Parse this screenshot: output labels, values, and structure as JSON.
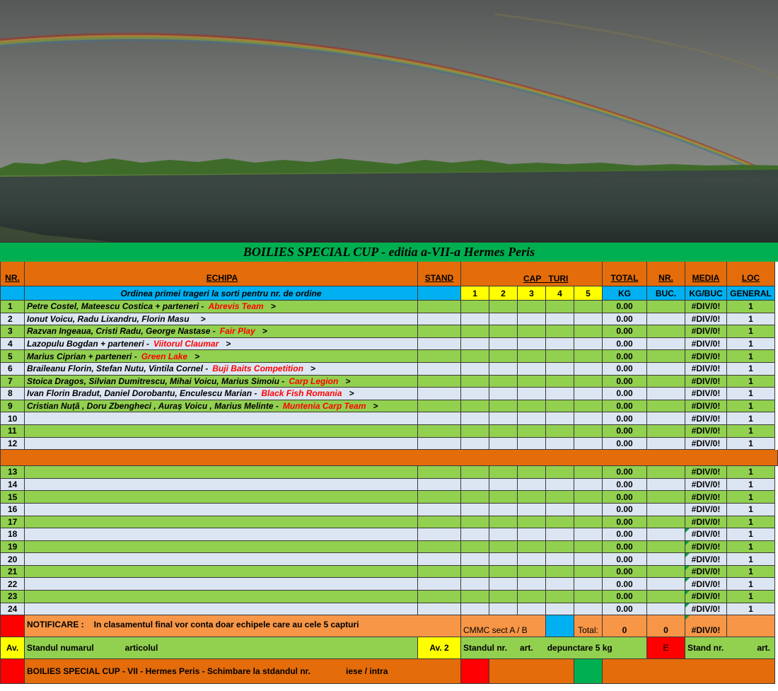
{
  "title": "BOILIES SPECIAL CUP - editia a-VII-a Hermes Peris",
  "headers": {
    "nr": "NR.",
    "echipa": "ECHIPA",
    "stand": "STAND",
    "cap": "CAP",
    "turi": "TURI",
    "total": "TOTAL",
    "nr_buc": "NR.",
    "media": "MEDIA",
    "loc": "LOC"
  },
  "subheaders": {
    "order_note": "Ordinea primei trageri la sorti pentru nr. de ordine",
    "rounds": [
      "1",
      "2",
      "3",
      "4",
      "5"
    ],
    "kg": "KG",
    "buc": "BUC.",
    "kg_buc": "KG/BUC",
    "general": "GENERAL"
  },
  "rows_top": [
    {
      "nr": "1",
      "members": "Petre Costel, Mateescu Costica + parteneri  -",
      "team": "Abrevis Team",
      "arrow": ">",
      "total": "0.00",
      "media": "#DIV/0!",
      "loc": "1"
    },
    {
      "nr": "2",
      "members": "Ionut Voicu, Radu Lixandru, Florin Masu",
      "team": "",
      "arrow": ">",
      "total": "0.00",
      "media": "#DIV/0!",
      "loc": "1"
    },
    {
      "nr": "3",
      "members": "Razvan Ingeaua, Cristi Radu, George Nastase  -",
      "team": "Fair Play",
      "arrow": ">",
      "total": "0.00",
      "media": "#DIV/0!",
      "loc": "1"
    },
    {
      "nr": "4",
      "members": "Lazopulu Bogdan + parteneri  -",
      "team": "Viitorul Claumar",
      "arrow": ">",
      "total": "0.00",
      "media": "#DIV/0!",
      "loc": "1"
    },
    {
      "nr": "5",
      "members": "Marius Ciprian + parteneri  -",
      "team": "Green Lake",
      "arrow": ">",
      "total": "0.00",
      "media": "#DIV/0!",
      "loc": "1"
    },
    {
      "nr": "6",
      "members": "Braileanu Florin, Stefan Nutu, Vintila Cornel  -",
      "team": "Buji Baits Competition",
      "arrow": ">",
      "total": "0.00",
      "media": "#DIV/0!",
      "loc": "1"
    },
    {
      "nr": "7",
      "members": "Stoica Dragos, Silvian Dumitrescu, Mihai Voicu, Marius Simoiu  -",
      "team": "Carp Legion",
      "arrow": ">",
      "total": "0.00",
      "media": "#DIV/0!",
      "loc": "1"
    },
    {
      "nr": "8",
      "members": "Ivan Florin Bradut, Daniel Dorobantu, Enculescu Marian  -",
      "team": "Black Fish Romania",
      "arrow": ">",
      "total": "0.00",
      "media": "#DIV/0!",
      "loc": "1"
    },
    {
      "nr": "9",
      "members": "Cristian Nuță , Doru Zbengheci , Auraș Voicu , Marius Melinte  -",
      "team": "Muntenia Carp Team",
      "arrow": ">",
      "total": "0.00",
      "media": "#DIV/0!",
      "loc": "1"
    },
    {
      "nr": "10",
      "members": "",
      "team": "",
      "arrow": "",
      "total": "0.00",
      "media": "#DIV/0!",
      "loc": "1"
    },
    {
      "nr": "11",
      "members": "",
      "team": "",
      "arrow": "",
      "total": "0.00",
      "media": "#DIV/0!",
      "loc": "1"
    },
    {
      "nr": "12",
      "members": "",
      "team": "",
      "arrow": "",
      "total": "0.00",
      "media": "#DIV/0!",
      "loc": "1"
    }
  ],
  "rows_bottom": [
    {
      "nr": "13",
      "total": "0.00",
      "media": "#DIV/0!",
      "loc": "1"
    },
    {
      "nr": "14",
      "total": "0.00",
      "media": "#DIV/0!",
      "loc": "1"
    },
    {
      "nr": "15",
      "total": "0.00",
      "media": "#DIV/0!",
      "loc": "1"
    },
    {
      "nr": "16",
      "total": "0.00",
      "media": "#DIV/0!",
      "loc": "1"
    },
    {
      "nr": "17",
      "total": "0.00",
      "media": "#DIV/0!",
      "loc": "1"
    },
    {
      "nr": "18",
      "total": "0.00",
      "media": "#DIV/0!",
      "loc": "1"
    },
    {
      "nr": "19",
      "total": "0.00",
      "media": "#DIV/0!",
      "loc": "1"
    },
    {
      "nr": "20",
      "total": "0.00",
      "media": "#DIV/0!",
      "loc": "1"
    },
    {
      "nr": "21",
      "total": "0.00",
      "media": "#DIV/0!",
      "loc": "1"
    },
    {
      "nr": "22",
      "total": "0.00",
      "media": "#DIV/0!",
      "loc": "1"
    },
    {
      "nr": "23",
      "total": "0.00",
      "media": "#DIV/0!",
      "loc": "1"
    },
    {
      "nr": "24",
      "total": "0.00",
      "media": "#DIV/0!",
      "loc": "1"
    }
  ],
  "notification": {
    "label": "NOTIFICARE :",
    "text": "In clasamentul final vor conta doar echipele care au cele 5 capturi",
    "cmmc": "CMMC sect  A / B",
    "total_label": "Total:",
    "total_kg": "0",
    "total_buc": "0",
    "total_media": "#DIV/0!"
  },
  "warning_row": {
    "av": "Av.",
    "stand_text": "Standul numarul",
    "art_text": "articolul",
    "av2": "Av. 2",
    "stand_nr": "Standul  nr.",
    "art": "art.",
    "penalty": "depunctare 5 kg",
    "e": "E",
    "stand_nr2": "Stand nr.",
    "art2": "art."
  },
  "change_row": {
    "text": "BOILIES SPECIAL CUP - VII - Hermes Peris - Schimbare la stdandul  nr.",
    "in_out": "iese / intra"
  },
  "colors": {
    "orange": "#e46c0a",
    "light_orange": "#f79646",
    "green": "#92d050",
    "bright_green": "#00b050",
    "light_blue": "#dce6f2",
    "cyan": "#00b0f0",
    "yellow": "#ffff00",
    "red": "#ff0000"
  }
}
